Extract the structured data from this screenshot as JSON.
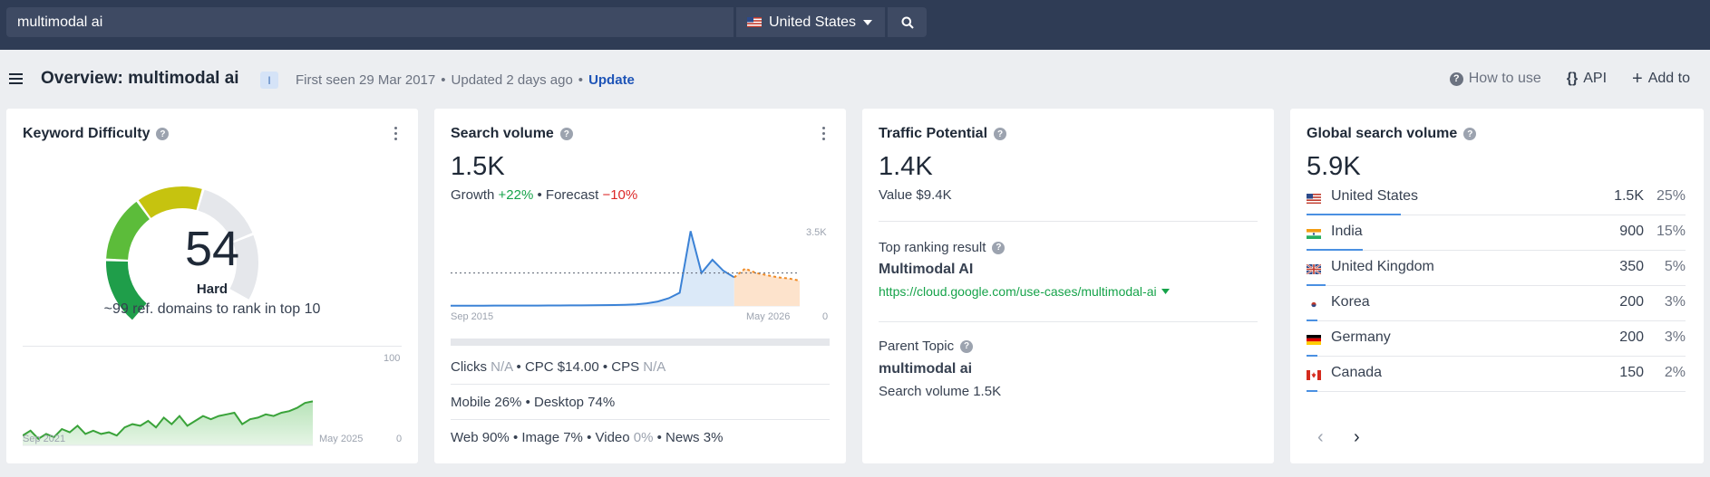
{
  "search": {
    "value": "multimodal ai",
    "country": "United States",
    "search_icon": "search-icon"
  },
  "header": {
    "title": "Overview: multimodal ai",
    "intent_badge": "I",
    "first_seen": "First seen 29 Mar 2017",
    "updated": "Updated 2 days ago",
    "update_link": "Update",
    "how_to_use": "How to use",
    "api": "API",
    "add_to": "Add to"
  },
  "keyword_difficulty": {
    "title": "Keyword Difficulty",
    "value": "54",
    "label": "Hard",
    "sub": "~99 ref. domains to rank in top 10",
    "chart_x_start": "Sep 2021",
    "chart_x_end": "May 2025",
    "chart_y_max": "100",
    "chart_y_min": "0"
  },
  "search_volume": {
    "title": "Search volume",
    "value": "1.5K",
    "growth_label": "Growth",
    "growth_value": "+22%",
    "forecast_label": "Forecast",
    "forecast_value": "−10%",
    "chart_x_start": "Sep 2015",
    "chart_x_end": "May 2026",
    "chart_y_max": "3.5K",
    "chart_y_min": "0",
    "clicks_label": "Clicks",
    "clicks_value": "N/A",
    "cpc": "CPC $14.00",
    "cps_label": "CPS",
    "cps_value": "N/A",
    "mobile": "Mobile 26%",
    "desktop": "Desktop 74%",
    "web": "Web 90%",
    "image": "Image 7%",
    "video_label": "Video",
    "video_value": "0%",
    "news": "News 3%"
  },
  "traffic_potential": {
    "title": "Traffic Potential",
    "value": "1.4K",
    "value_text": "Value $9.4K",
    "top_ranking_label": "Top ranking result",
    "top_ranking_title": "Multimodal AI",
    "top_ranking_url": "https://cloud.google.com/use-cases/multimodal-ai",
    "parent_topic_label": "Parent Topic",
    "parent_topic": "multimodal ai",
    "parent_volume": "Search volume 1.5K"
  },
  "global_volume": {
    "title": "Global search volume",
    "value": "5.9K",
    "countries": [
      {
        "name": "United States",
        "volume": "1.5K",
        "pct": "25%",
        "share": 25
      },
      {
        "name": "India",
        "volume": "900",
        "pct": "15%",
        "share": 15
      },
      {
        "name": "United Kingdom",
        "volume": "350",
        "pct": "5%",
        "share": 5
      },
      {
        "name": "Korea",
        "volume": "200",
        "pct": "3%",
        "share": 3
      },
      {
        "name": "Germany",
        "volume": "200",
        "pct": "3%",
        "share": 3
      },
      {
        "name": "Canada",
        "volume": "150",
        "pct": "2%",
        "share": 2
      }
    ]
  },
  "chart_data": [
    {
      "type": "area",
      "x": [
        "Sep 2021",
        "",
        "",
        "",
        "",
        "",
        "",
        "",
        "",
        "",
        "",
        "",
        "",
        "",
        "",
        "",
        "",
        "",
        "",
        "",
        "",
        "",
        "",
        "",
        "",
        "",
        "",
        "",
        "",
        "",
        "",
        "",
        "",
        "",
        "",
        "May 2025"
      ],
      "values": [
        12,
        18,
        8,
        14,
        10,
        20,
        16,
        24,
        14,
        18,
        14,
        16,
        12,
        22,
        26,
        24,
        30,
        22,
        34,
        26,
        36,
        24,
        30,
        36,
        32,
        36,
        38,
        40,
        26,
        32,
        34,
        38,
        36,
        40,
        42,
        46,
        52,
        54
      ],
      "ylim": [
        0,
        100
      ]
    },
    {
      "type": "area",
      "x": [
        "Sep 2015",
        "May 2026"
      ],
      "values": [
        10,
        10,
        12,
        12,
        14,
        15,
        16,
        16,
        18,
        20,
        22,
        25,
        28,
        30,
        35,
        40,
        50,
        70,
        120,
        200,
        350,
        600,
        3400,
        1500,
        2100,
        1600,
        1300,
        1700,
        1500,
        1400,
        1300,
        1250,
        1150
      ],
      "forecast_start": 26,
      "average": 1500,
      "ylim": [
        0,
        3500
      ]
    }
  ]
}
